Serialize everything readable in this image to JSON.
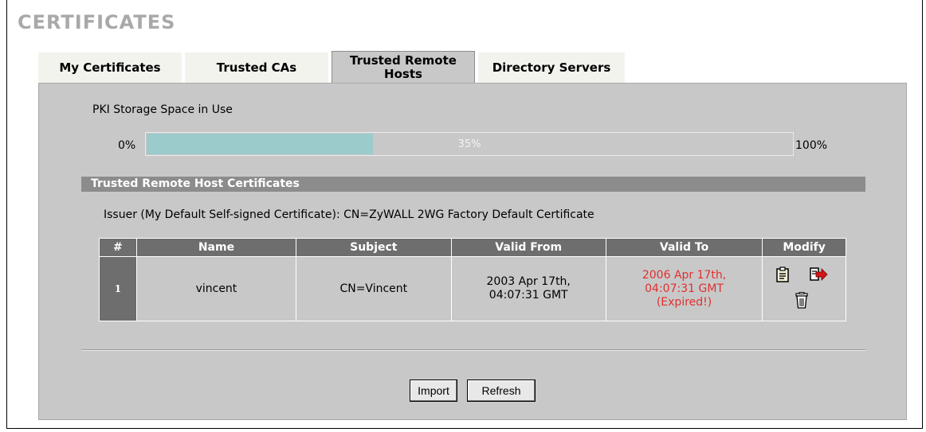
{
  "page": {
    "title": "CERTIFICATES"
  },
  "tabs": [
    {
      "label": "My Certificates"
    },
    {
      "label": "Trusted CAs"
    },
    {
      "label": "Trusted Remote Hosts"
    },
    {
      "label": "Directory Servers"
    }
  ],
  "storage": {
    "label": "PKI Storage Space in Use",
    "min_label": "0%",
    "max_label": "100%",
    "usage_text": "35%",
    "usage_fraction": 0.35,
    "bar_color": "#9ccbcc"
  },
  "section": {
    "title": "Trusted Remote Host Certificates",
    "issuer": "Issuer (My Default Self-signed Certificate): CN=ZyWALL 2WG Factory Default Certificate"
  },
  "table": {
    "headers": [
      "#",
      "Name",
      "Subject",
      "Valid From",
      "Valid To",
      "Modify"
    ],
    "rows": [
      {
        "num": "1",
        "name": "vincent",
        "subject": "CN=Vincent",
        "valid_from_date": "2003 Apr 17th,",
        "valid_from_time": "04:07:31 GMT",
        "valid_to_date": "2006 Apr 17th,",
        "valid_to_time": "04:07:31 GMT",
        "valid_to_status": "(Expired!)",
        "expired_color": "#e03030",
        "icons": [
          "details-icon",
          "export-icon",
          "delete-icon"
        ]
      }
    ]
  },
  "buttons": {
    "import": "Import",
    "refresh": "Refresh"
  }
}
